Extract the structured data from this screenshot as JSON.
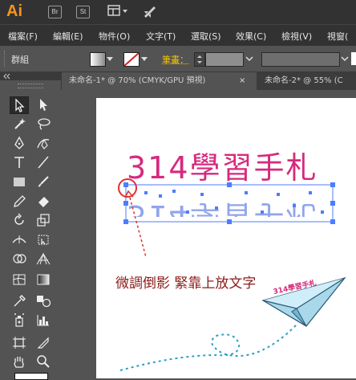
{
  "app": {
    "logo": "Ai",
    "bridge_label": "Br",
    "stock_label": "St"
  },
  "menubar": {
    "items": [
      "檔案(F)",
      "編輯(E)",
      "物件(O)",
      "文字(T)",
      "選取(S)",
      "效果(C)",
      "檢視(V)",
      "視窗("
    ]
  },
  "control": {
    "selection_label": "群組",
    "stroke_label": "筆畫："
  },
  "tabs": [
    {
      "label": "未命名-1* @ 70% (CMYK/GPU 預視)",
      "close": "×"
    },
    {
      "label": "未命名-2* @ 55% (C",
      "close": ""
    }
  ],
  "artwork": {
    "title": "314學習手札",
    "caption": "微調倒影 緊靠上放文字",
    "plane_text": "314學習手札"
  },
  "colors": {
    "title": "#d62a7d",
    "caption": "#8b1a1a",
    "selection": "#4d7dff",
    "arrow": "#e03030",
    "path": "#2aa0c8",
    "plane": "#a8d8ea"
  },
  "tools": [
    "selection-tool",
    "direct-selection-tool",
    "magic-wand-tool",
    "lasso-tool",
    "pen-tool",
    "curvature-tool",
    "type-tool",
    "line-tool",
    "rectangle-tool",
    "paintbrush-tool",
    "pencil-tool",
    "eraser-tool",
    "rotate-tool",
    "scale-tool",
    "width-tool",
    "free-transform-tool",
    "shape-builder-tool",
    "perspective-grid-tool",
    "mesh-tool",
    "gradient-tool",
    "eyedropper-tool",
    "blend-tool",
    "symbol-sprayer-tool",
    "column-graph-tool",
    "artboard-tool",
    "slice-tool",
    "hand-tool",
    "zoom-tool"
  ]
}
